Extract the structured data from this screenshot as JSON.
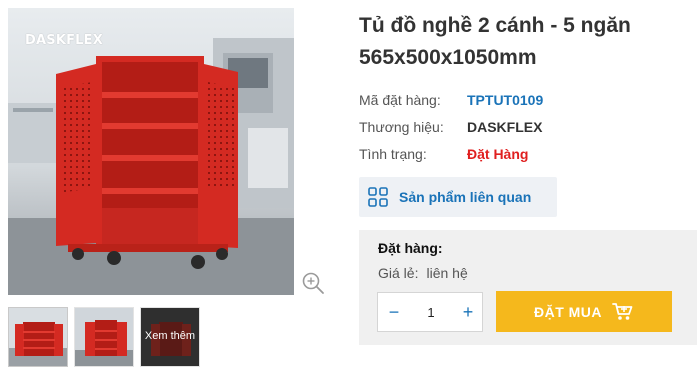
{
  "gallery": {
    "brand_logo": "DASKFLEX",
    "zoom_icon": "zoom-in-icon",
    "more_label": "Xem thêm"
  },
  "product": {
    "title": "Tủ đồ nghề 2 cánh - 5 ngăn 565x500x1050mm",
    "code_label": "Mã đặt hàng:",
    "code_value": "TPTUT0109",
    "brand_label": "Thương hiệu:",
    "brand_value": "DASKFLEX",
    "status_label": "Tình trạng:",
    "status_value": "Đặt Hàng"
  },
  "related": {
    "icon": "grid-icon",
    "label": "Sản phẩm liên quan"
  },
  "order": {
    "title": "Đặt hàng:",
    "price_label": "Giá lẻ:",
    "price_value": "liên hệ",
    "quantity": "1",
    "minus": "−",
    "plus": "+",
    "buy_label": "ĐẶT MUA",
    "buy_icon": "cart-icon"
  },
  "colors": {
    "accent_blue": "#1a73b8",
    "status_red": "#e02020",
    "buy_yellow": "#f5b81c",
    "cabinet_red": "#d42a22"
  }
}
